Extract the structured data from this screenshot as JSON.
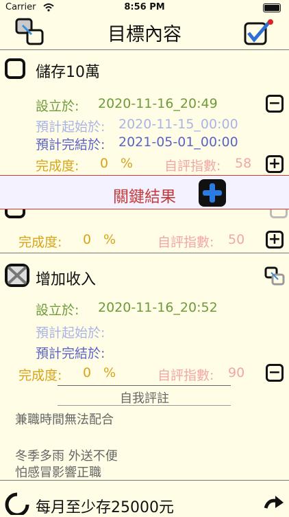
{
  "status": {
    "carrier": "Carrier",
    "time": "8:56 PM"
  },
  "header": {
    "title": "目標內容"
  },
  "goal1": {
    "title": "儲存10萬",
    "created_label": "設立於:",
    "created_value": "2020-11-16_20:49",
    "start_label": "預計起始於:",
    "start_value": "2020-11-15_00:00",
    "end_label": "預計完結於:",
    "end_value": "2021-05-01_00:00",
    "progress_label": "完成度:",
    "progress_value": "0",
    "progress_unit": "%",
    "rating_label": "自評指數:",
    "rating_value": "58"
  },
  "key_results": {
    "label": "關鍵結果"
  },
  "kr_item": {
    "progress_label": "完成度:",
    "progress_value": "0",
    "progress_unit": "%",
    "rating_label": "自評指數:",
    "rating_value": "50"
  },
  "goal2": {
    "title": "增加收入",
    "created_label": "設立於:",
    "created_value": "2020-11-16_20:52",
    "start_label": "預計起始於:",
    "end_label": "預計完結於:",
    "progress_label": "完成度:",
    "progress_value": "0",
    "progress_unit": "%",
    "rating_label": "自評指數:",
    "rating_value": "90",
    "self_eval_title": "自我評註",
    "notes": [
      "兼職時間無法配合",
      "冬季多雨 外送不便",
      "怕感冒影響正職"
    ]
  },
  "goal3": {
    "title": "每月至少存25000元"
  },
  "colors": {
    "background": "#fffde6",
    "created": "#6e9b39",
    "start": "#aab3e6",
    "end": "#5a63c6",
    "progress": "#d6a419",
    "rating": "#f2a6a6",
    "key_result": "#c23b3b"
  }
}
